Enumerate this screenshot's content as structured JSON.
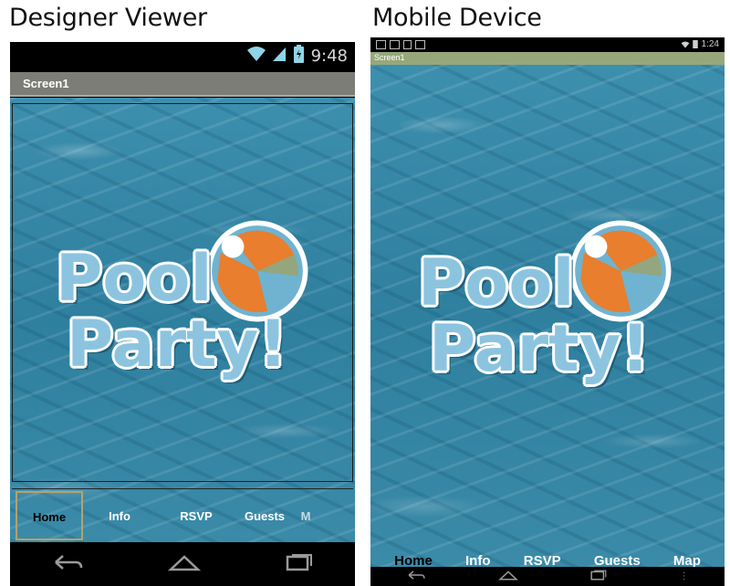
{
  "captions": {
    "designer": "Designer Viewer",
    "mobile": "Mobile Device"
  },
  "designer": {
    "status_time": "9:48",
    "screen_title": "Screen1",
    "logo_line1": "Pool",
    "logo_line2": "Party!",
    "tabs": [
      {
        "label": "Home",
        "selected": true
      },
      {
        "label": "Info",
        "selected": false
      },
      {
        "label": "RSVP",
        "selected": false
      },
      {
        "label": "Guests",
        "selected": false
      },
      {
        "label": "M",
        "selected": false
      }
    ]
  },
  "mobile": {
    "status_time": "1:24",
    "screen_title": "Screen1",
    "logo_line1": "Pool",
    "logo_line2": "Party!",
    "tabs": [
      {
        "label": "Home"
      },
      {
        "label": "Info"
      },
      {
        "label": "RSVP"
      },
      {
        "label": "Guests"
      },
      {
        "label": "Map"
      }
    ]
  },
  "icons": {
    "wifi": "wifi-icon",
    "battery": "battery-icon",
    "back": "back-icon",
    "home": "home-icon",
    "recents": "recents-icon",
    "notifications": "notification-icon"
  },
  "colors": {
    "pool_blue": "#3d8fae",
    "logo_text": "#8cc4e0",
    "titlebar_designer": "#7d7d77",
    "titlebar_mobile": "#96a87a",
    "ball_orange": "#e87e2e",
    "ball_blue": "#6fb3d1",
    "ball_green": "#93a67e"
  }
}
